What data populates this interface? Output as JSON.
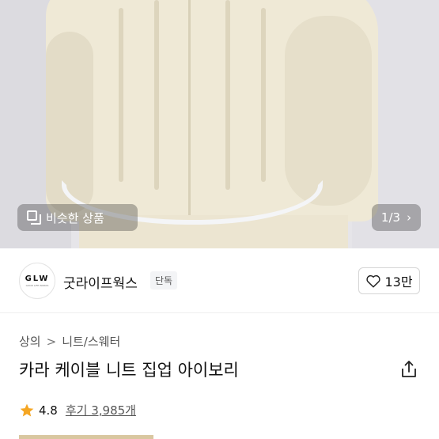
{
  "gallery": {
    "similar_label": "비슷한 상품",
    "page_indicator": "1/3",
    "colors": {
      "pill_bg": "rgba(40,40,40,0.32)",
      "image_bg": "#e6e5e9",
      "sweater": "#efe9d6"
    }
  },
  "seller": {
    "logo_text": "GLW",
    "logo_subtext": "GOOD LIFE WORKS",
    "name": "굿라이프웍스",
    "badge": "단독",
    "like_count": "13만"
  },
  "breadcrumb": {
    "items": [
      "상의",
      "니트/스웨터"
    ],
    "separator": ">"
  },
  "product": {
    "title": "카라 케이블 니트 집업 아이보리"
  },
  "rating": {
    "value": "4.8",
    "review_text": "후기 3,985개",
    "star_color": "#f5a623"
  },
  "icons": {
    "similar": "similar-items-icon",
    "chevron": "chevron-right-icon",
    "heart": "heart-outline-icon",
    "share": "share-icon",
    "star": "star-icon"
  }
}
